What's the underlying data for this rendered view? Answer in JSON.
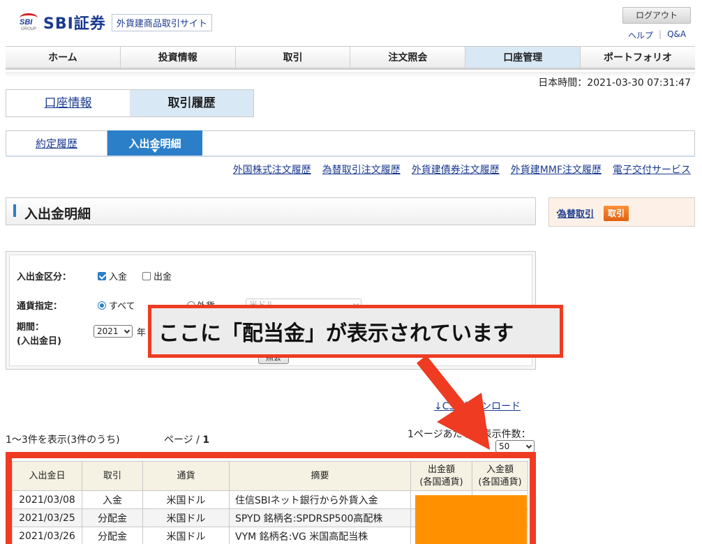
{
  "header": {
    "brand_mark": "SBI",
    "brand_group": "GROUP",
    "brand_name": "SBI証券",
    "site_tag": "外貨建商品取引サイト",
    "logout_label": "ログアウト",
    "help_label": "ヘルプ",
    "qa_label": "Q&A"
  },
  "nav": {
    "items": [
      "ホーム",
      "投資情報",
      "取引",
      "注文照会",
      "口座管理",
      "ポートフォリオ"
    ],
    "active_index": 4
  },
  "clock": "日本時間：2021-03-30 07:31:47",
  "subtabs": {
    "account_info": "口座情報",
    "trade_history": "取引履歴"
  },
  "tabs2": {
    "contract_history": "約定履歴",
    "cash_flow": "入出金明細"
  },
  "history_links": [
    "外国株式注文履歴",
    "為替取引注文履歴",
    "外貨建債券注文履歴",
    "外貨建MMF注文履歴",
    "電子交付サービス"
  ],
  "section": {
    "title": "入出金明細"
  },
  "side": {
    "dot": "・",
    "fx_link": "為替取引",
    "order_label": "取引"
  },
  "filter": {
    "type_label": "入出金区分：",
    "deposit_label": "入金",
    "deposit_checked": true,
    "withdraw_label": "出金",
    "withdraw_checked": false,
    "currency_label": "通貨指定：",
    "all_label": "すべて",
    "foreign_label": "外貨",
    "currency_select": "米ドル",
    "period_label": "期間：",
    "period_sublabel": "(入出金日)",
    "year_value": "2021",
    "year_unit": "年",
    "search_label": "照会"
  },
  "callout": {
    "text": "ここに「配当金」が表示されています"
  },
  "listing": {
    "csv_link": "↓CSVダウンロード",
    "count_text": "1〜3件を表示(3件のうち)",
    "page_prefix": "ページ / ",
    "page_number": "1",
    "per_page_label": "1ページあたりの表示件数：",
    "per_page_value": "50"
  },
  "table": {
    "headers": [
      "入出金日",
      "取引",
      "通貨",
      "摘要",
      "出金額\n(各国通貨)",
      "入金額\n(各国通貨)"
    ],
    "rows": [
      [
        "2021/03/08",
        "入金",
        "米国ドル",
        "住信SBIネット銀行から外貨入金",
        "",
        ""
      ],
      [
        "2021/03/25",
        "分配金",
        "米国ドル",
        "SPYD 銘柄名:SPDRSP500高配株",
        "",
        ""
      ],
      [
        "2021/03/26",
        "分配金",
        "米国ドル",
        "VYM 銘柄名:VG 米国高配当株",
        "",
        ""
      ]
    ]
  },
  "colors": {
    "brand_blue": "#1a3a8f",
    "accent_blue": "#2b7fc9",
    "callout_red": "#ee3b22",
    "highlight_orange": "#ff9100"
  }
}
